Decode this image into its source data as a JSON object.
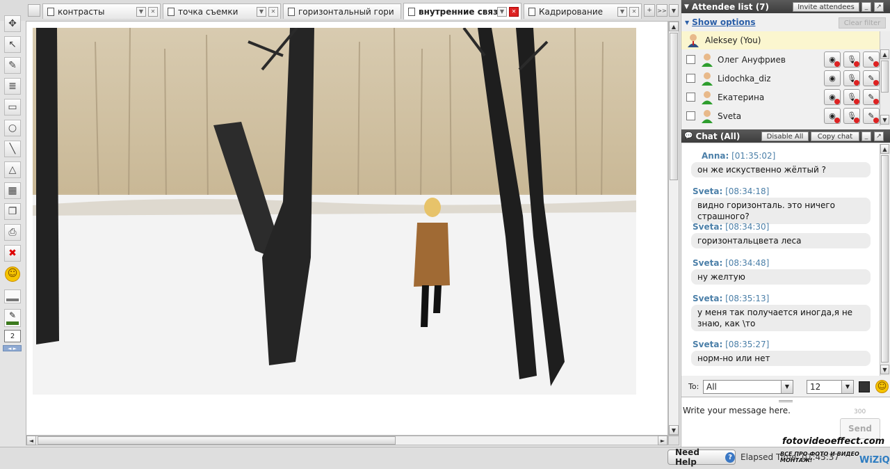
{
  "tabs": [
    {
      "label": "контрасты",
      "active": false
    },
    {
      "label": "точка съемки",
      "active": false
    },
    {
      "label": "горизонтальный гори",
      "active": false
    },
    {
      "label": "внутренние связи",
      "active": true
    },
    {
      "label": "Кадрирование",
      "active": false
    }
  ],
  "tab_controls": {
    "add": "+",
    "more": ">>",
    "dropdown": "▼"
  },
  "toolbar": {
    "tools": [
      {
        "name": "select-arrow-tool",
        "glyph": "➤"
      },
      {
        "name": "pointer-tool",
        "glyph": "↖"
      },
      {
        "name": "pencil-tool",
        "glyph": "✎"
      },
      {
        "name": "text-tool",
        "glyph": "≣"
      },
      {
        "name": "rectangle-tool",
        "glyph": "▭"
      },
      {
        "name": "circle-tool",
        "glyph": "○"
      },
      {
        "name": "line-tool",
        "glyph": "╲"
      },
      {
        "name": "triangle-tool",
        "glyph": "△"
      },
      {
        "name": "table-tool",
        "glyph": "▦"
      },
      {
        "name": "layers-tool",
        "glyph": "❐"
      },
      {
        "name": "screenshot-tool",
        "glyph": "⎙"
      },
      {
        "name": "delete-tool",
        "glyph": "✖"
      },
      {
        "name": "smiley-tool",
        "glyph": "☺"
      }
    ],
    "line_width": "2"
  },
  "attendees": {
    "header": "Attendee list (7)",
    "invite_label": "Invite attendees",
    "show_options": "Show options",
    "clear_filter": "Clear filter",
    "self": "Aleksey (You)",
    "list": [
      {
        "name": "Олег Ануфриев"
      },
      {
        "name": "Lidochka_diz"
      },
      {
        "name": "Екатерина"
      },
      {
        "name": "Sveta"
      }
    ]
  },
  "chat": {
    "header": "Chat (All)",
    "disable_all": "Disable All",
    "copy_chat": "Copy chat",
    "messages": [
      {
        "name": "Anna:",
        "time": "[01:35:02]",
        "text": "он же искуственно жёлтый ?"
      },
      {
        "name": "Sveta:",
        "time": "[08:34:18]",
        "text": "видно горизонталь. это ничего страшного?"
      },
      {
        "name": "Sveta:",
        "time": "[08:34:30]",
        "text": "горизонтальцвета леса"
      },
      {
        "name": "Sveta:",
        "time": "[08:34:48]",
        "text": "ну желтую"
      },
      {
        "name": "Sveta:",
        "time": "[08:35:13]",
        "text": "у меня так получается иногда,я не знаю, как \\то"
      },
      {
        "name": "Sveta:",
        "time": "[08:35:27]",
        "text": "норм-но или нет"
      }
    ],
    "to_label": "To:",
    "to_value": "All",
    "font_size": "12",
    "input_placeholder": "Write your message here.",
    "char_limit": "300",
    "send": "Send"
  },
  "footer": {
    "need_help": "Need Help",
    "elapsed": "Elapsed Time: 01:45:37",
    "watermark": "fotovideoeffect.com",
    "watermark_sub": "ВСЕ ПРО ФОТО И ВИДЕО МОНТАЖ!",
    "brand": "WiZiQ"
  },
  "colors": {
    "header_dark": "#3c3c3c",
    "chat_name": "#4b7fa8",
    "self_highlight": "#fbf6cf"
  }
}
